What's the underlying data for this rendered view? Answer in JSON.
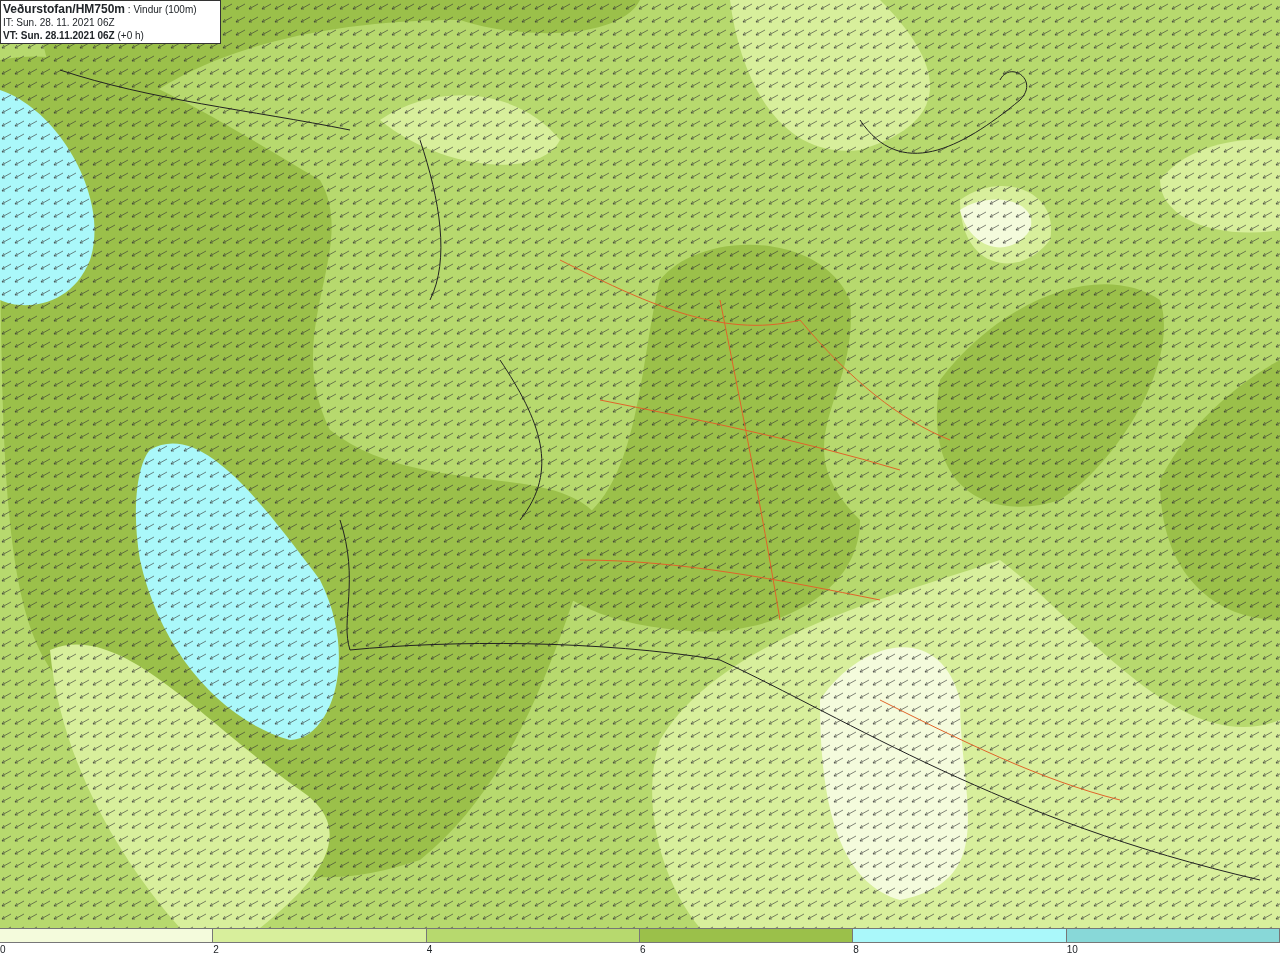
{
  "header": {
    "lines": [
      "**Veðurstofan/HM750m** : Vindur (100m)",
      "IT: Sun. 28. 11. 2021 06Z",
      "**VT: Sun. 28.11.2021 06Z** (+0 h)"
    ]
  },
  "legend": {
    "segments": [
      {
        "color": "#f4fbdc"
      },
      {
        "color": "#d8ef9c"
      },
      {
        "color": "#b7d96e"
      },
      {
        "color": "#9bc04a"
      },
      {
        "color": "#aaf8fa"
      },
      {
        "color": "#88d8d8"
      }
    ],
    "labels": [
      "0",
      "2",
      "4",
      "6",
      "8",
      "10"
    ]
  }
}
